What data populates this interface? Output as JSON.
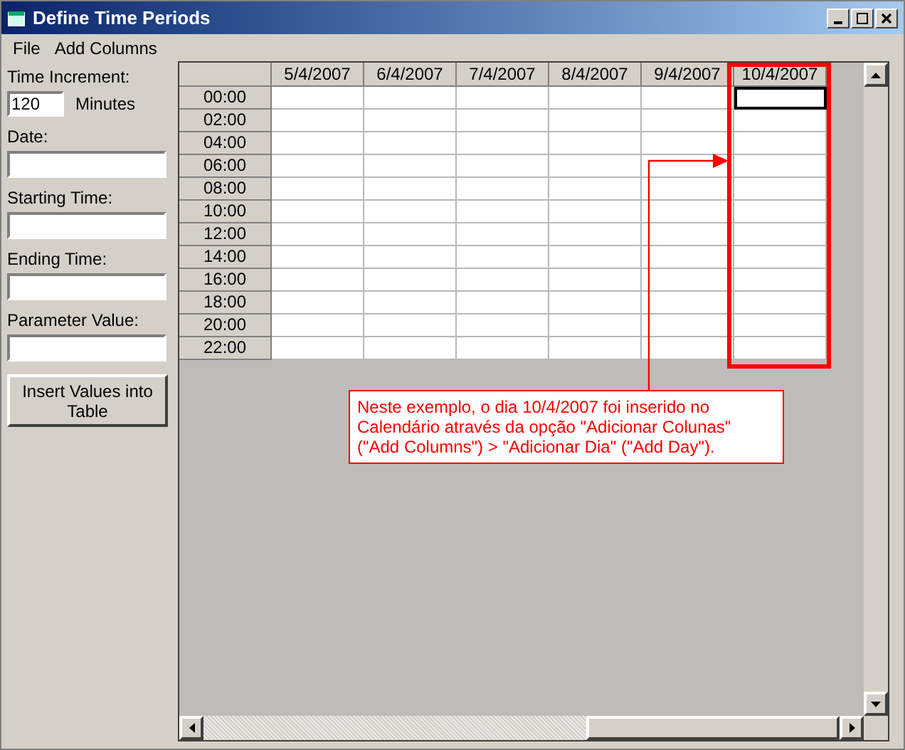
{
  "window": {
    "title": "Define Time Periods"
  },
  "menu": [
    "File",
    "Add Columns"
  ],
  "increment": {
    "label": "Time Increment:",
    "value": "120",
    "unit": "Minutes"
  },
  "fields": [
    {
      "label": "Date:"
    },
    {
      "label": "Starting Time:"
    },
    {
      "label": "Ending Time:"
    },
    {
      "label": "Parameter Value:"
    }
  ],
  "insert_button": "Insert Values into Table",
  "table": {
    "columns": [
      {
        "label": "5/4/2007",
        "highlighted": false
      },
      {
        "label": "6/4/2007",
        "highlighted": false
      },
      {
        "label": "7/4/2007",
        "highlighted": false
      },
      {
        "label": "8/4/2007",
        "highlighted": false
      },
      {
        "label": "9/4/2007",
        "highlighted": false
      },
      {
        "label": "10/4/2007",
        "highlighted": true
      }
    ],
    "rows": [
      "00:00",
      "02:00",
      "04:00",
      "06:00",
      "08:00",
      "10:00",
      "12:00",
      "14:00",
      "16:00",
      "18:00",
      "20:00",
      "22:00"
    ]
  },
  "callout": "Neste exemplo, o dia 10/4/2007 foi inserido no Calendário através da opção \"Adicionar Colunas\" (\"Add Columns\") > \"Adicionar Dia\" (\"Add Day\")."
}
